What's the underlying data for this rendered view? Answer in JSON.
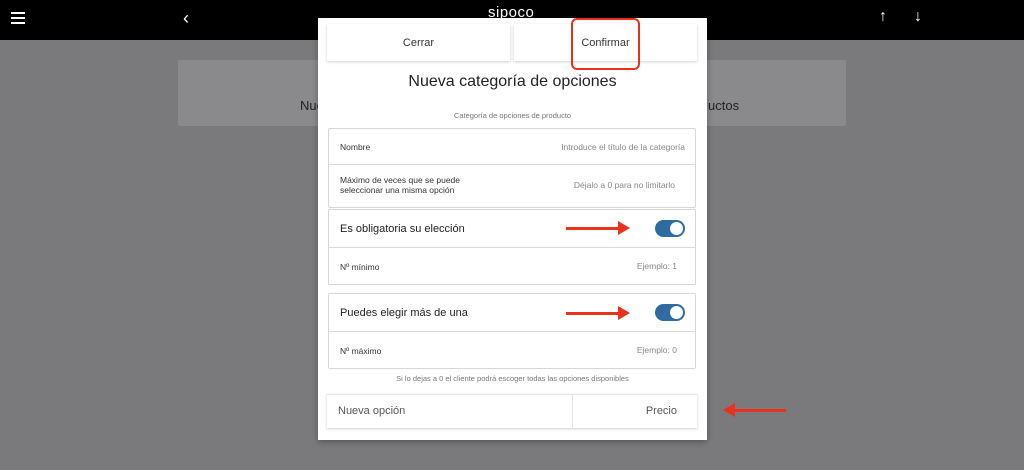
{
  "topbar": {
    "brand": "sipoco",
    "back_icon": "‹",
    "up_icon": "↑",
    "down_icon": "↓"
  },
  "background": {
    "left_text": "Nue",
    "right_text": "uctos"
  },
  "modal": {
    "close_label": "Cerrar",
    "confirm_label": "Confirmar",
    "title": "Nueva categoría de opciones",
    "subtitle": "Categoría de opciones de producto",
    "name_label": "Nombre",
    "name_placeholder": "Introduce el título de la categoría",
    "max_times_label_1": "Máximo de veces que se puede",
    "max_times_label_2": "seleccionar una misma opción",
    "max_times_placeholder": "Déjalo a 0 para no limitarlo",
    "required_label": "Es obligatoria su elección",
    "required_on": true,
    "min_label": "Nº mínimo",
    "min_placeholder": "Ejemplo: 1",
    "multiple_label": "Puedes elegir más de una",
    "multiple_on": true,
    "max_label": "Nº máximo",
    "max_placeholder": "Ejemplo: 0",
    "hint": "Si lo dejas a 0 el cliente podrá escoger todas las opciones disponibles",
    "new_option_placeholder": "Nueva opción",
    "price_placeholder": "Precio"
  },
  "colors": {
    "highlight": "#e8321e",
    "toggle_on": "#2f6b9e"
  }
}
